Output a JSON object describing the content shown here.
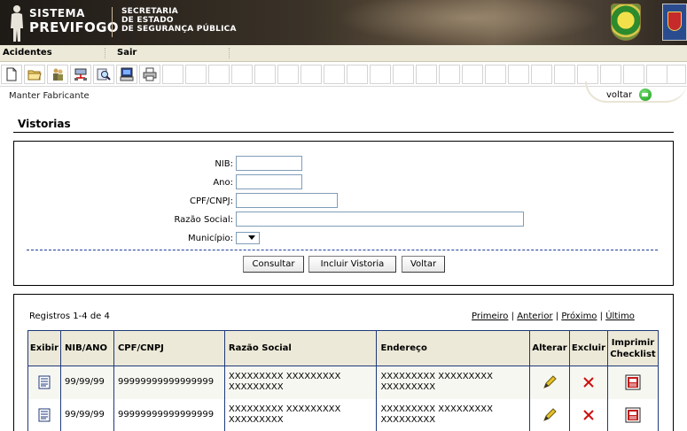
{
  "header": {
    "system_line1": "SISTEMA",
    "system_line2": "PREVIFOGO",
    "secretaria_line1": "SECRETARIA",
    "secretaria_line2": "DE ESTADO",
    "secretaria_line3": "DE SEGURANÇA PÚBLICA"
  },
  "menu": {
    "items": [
      "Acidentes",
      "Sair"
    ]
  },
  "toolbar": {
    "icons": [
      "new-document-icon",
      "open-folder-icon",
      "users-icon",
      "network-icon",
      "search-icon",
      "computer-icon",
      "printer-icon"
    ]
  },
  "breadcrumb": "Manter Fabricante",
  "back_link": "voltar",
  "page_title": "Vistorias",
  "form": {
    "nib_label": "NIB:",
    "ano_label": "Ano:",
    "cpf_label": "CPF/CNPJ:",
    "razao_label": "Razão Social:",
    "municipio_label": "Município:",
    "nib_value": "",
    "ano_value": "",
    "cpf_value": "",
    "razao_value": "",
    "municipio_value": ""
  },
  "buttons": {
    "consultar": "Consultar",
    "incluir": "Incluir Vistoria",
    "voltar": "Voltar"
  },
  "results": {
    "registros": "Registros 1-4 de 4",
    "pager": {
      "first": "Primeiro",
      "prev": "Anterior",
      "next": "Próximo",
      "last": "Último"
    },
    "columns": [
      "Exibir",
      "NIB/ANO",
      "CPF/CNPJ",
      "Razão Social",
      "Endereço",
      "Alterar",
      "Excluir",
      "Imprimir Checklist"
    ],
    "rows": [
      {
        "nib_ano": "99/99/99",
        "cpf": "99999999999999999",
        "razao": "XXXXXXXXX XXXXXXXXX XXXXXXXXX",
        "endereco": "XXXXXXXXX XXXXXXXXX XXXXXXXXX"
      },
      {
        "nib_ano": "99/99/99",
        "cpf": "99999999999999999",
        "razao": "XXXXXXXXX XXXXXXXXX XXXXXXXXX",
        "endereco": "XXXXXXXXX XXXXXXXXX XXXXXXXXX"
      }
    ]
  },
  "colors": {
    "table_border": "#1f3a7a",
    "header_bg": "#ece9d8",
    "dash": "#1f3f9a",
    "delete": "#cc1010"
  }
}
